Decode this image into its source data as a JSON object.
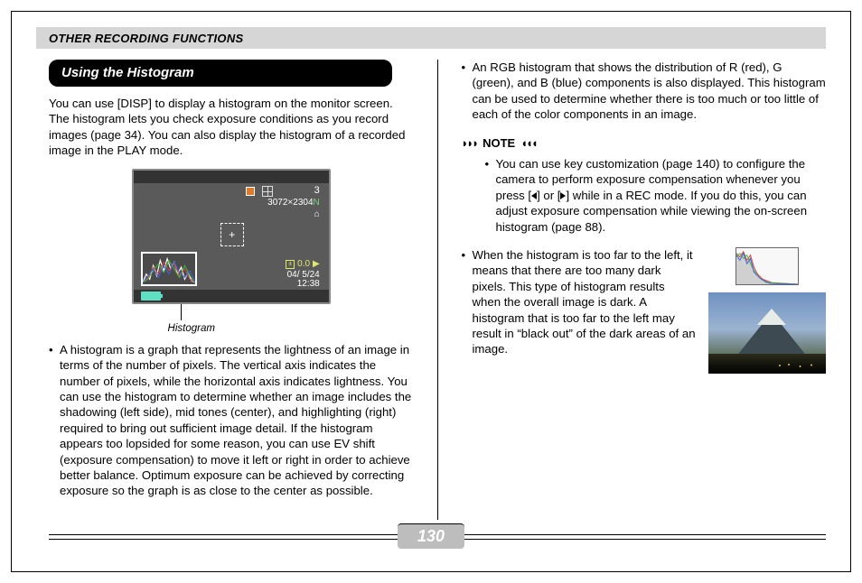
{
  "header": {
    "title": "OTHER RECORDING FUNCTIONS"
  },
  "section_title": "Using the Histogram",
  "left": {
    "intro": "You can use [DISP] to display a histogram on the monitor screen. The histogram lets you check exposure conditions as you record images (page 34). You can also display the histogram of a recorded image in the PLAY mode.",
    "histogram_caption": "Histogram",
    "bullet1": "A histogram is a graph that represents the lightness of an image in terms of the number of pixels. The vertical axis indicates the number of pixels, while the horizontal axis indicates lightness. You can use the histogram to determine whether an image includes the shadowing (left side), mid tones (center), and highlighting (right) required to bring out sufficient image detail. If the histogram appears too lopsided for some reason, you can use EV shift (exposure compensation) to move it left or right in order to achieve better balance. Optimum exposure can be achieved by correcting exposure so the graph is as close to the center as possible."
  },
  "screen": {
    "count": "3",
    "resolution_pre": "3072×2304",
    "resolution_suffix": "N",
    "house": "⌂",
    "ev": "0.0",
    "date": "04/ 5/24",
    "time": "12:38"
  },
  "right": {
    "bullet_rgb": "An RGB histogram that shows the distribution of R (red), G (green), and B (blue) components is also displayed. This histogram can be used to determine whether there is too much or too little of each of the color components in an image.",
    "note_label": "NOTE",
    "note_body_pre": "You can use key customization (page 140) to configure the camera to perform exposure compensation whenever you press [",
    "note_body_mid": "] or [",
    "note_body_post": "] while in a REC mode. If you do this, you can adjust exposure compensation while viewing the on-screen histogram (page 88).",
    "bullet_dark": "When the histogram is too far to the left, it means that there are too many dark pixels. This type of histogram results when the overall image is dark. A histogram that is too far to the left may result in “black out” of the dark areas of an image."
  },
  "page_number": "130"
}
